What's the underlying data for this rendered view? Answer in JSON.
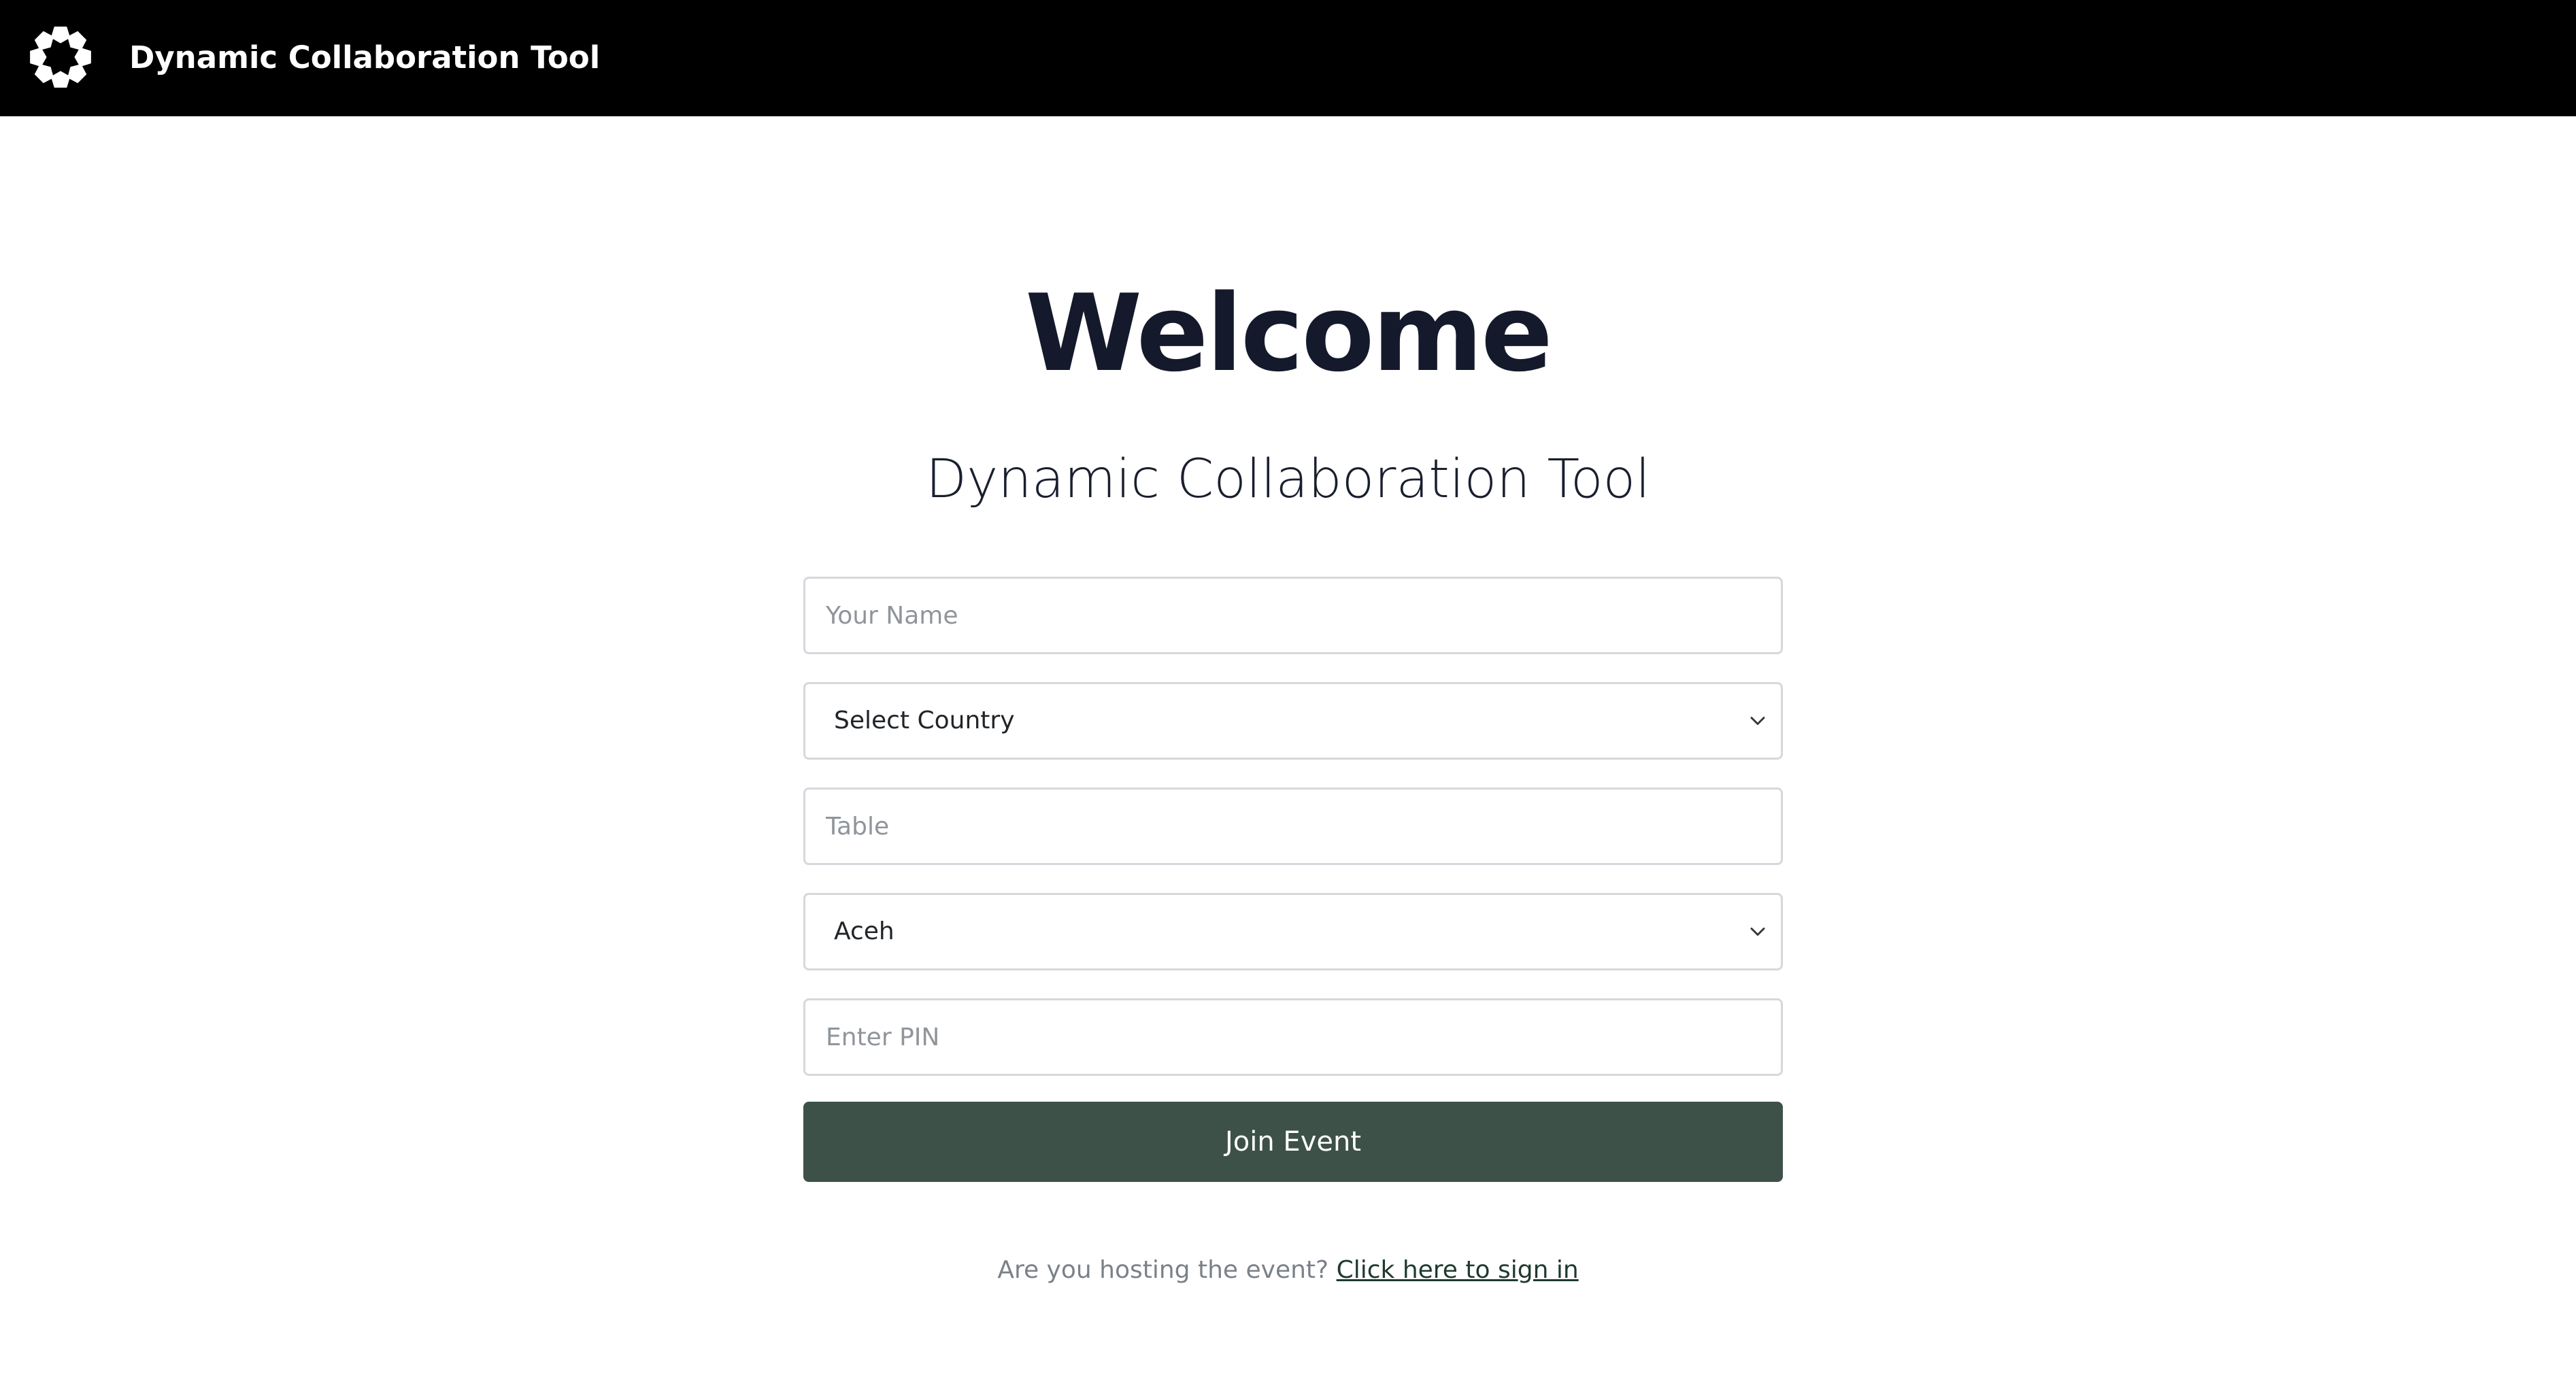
{
  "navbar": {
    "logo_icon": "flower-logo-icon",
    "title": "Dynamic Collaboration Tool",
    "background": "#000000"
  },
  "main": {
    "heading": "Welcome",
    "subtitle": "Dynamic Collaboration Tool"
  },
  "form": {
    "name": {
      "placeholder": "Your Name",
      "value": ""
    },
    "country": {
      "selected": "Select Country"
    },
    "table": {
      "placeholder": "Table",
      "value": ""
    },
    "region": {
      "selected": "Aceh"
    },
    "pin": {
      "placeholder": "Enter PIN",
      "value": ""
    },
    "join_label": "Join Event",
    "join_color": "#3d5148"
  },
  "footer": {
    "prompt": "Are you hosting the event?",
    "link": "Click here to sign in"
  }
}
